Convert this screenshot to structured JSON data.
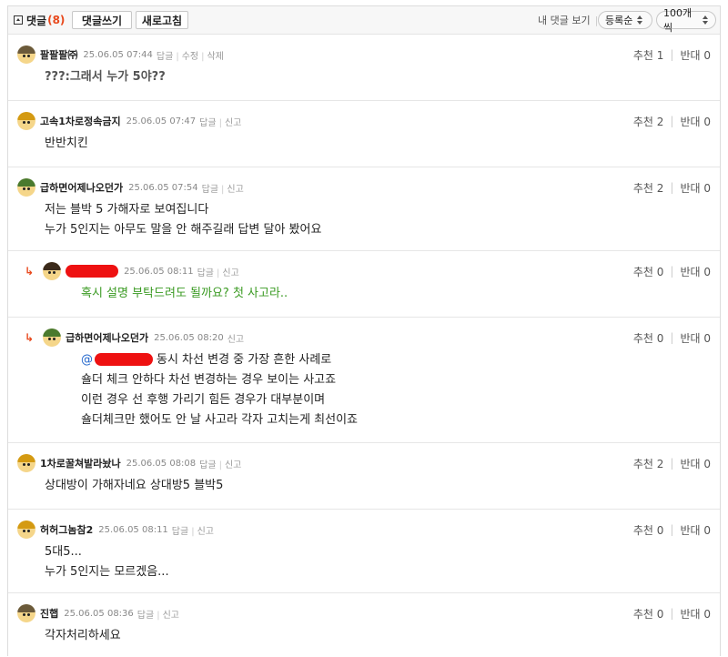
{
  "toolbar": {
    "comment_label": "댓글",
    "comment_count": "(8)",
    "write_button": "댓글쓰기",
    "refresh_button": "새로고침",
    "my_comments": "내 댓글 보기",
    "sort_select": "등록순",
    "per_page_select": "100개씩"
  },
  "comments": [
    {
      "nick": "팔팔팔㈜",
      "date": "25.06.05 07:44",
      "links": [
        "답글",
        "수정",
        "삭제"
      ],
      "up": "추천 1",
      "down": "반대 0",
      "lines": [
        "???:그래서 누가 5야??"
      ]
    },
    {
      "nick": "고속1차로정속금지",
      "date": "25.06.05 07:47",
      "links": [
        "답글",
        "신고"
      ],
      "up": "추천 2",
      "down": "반대 0",
      "lines": [
        "반반치킨"
      ]
    },
    {
      "nick": "급하면어제나오던가",
      "date": "25.06.05 07:54",
      "links": [
        "답글",
        "신고"
      ],
      "up": "추천 2",
      "down": "반대 0",
      "lines": [
        "저는 블박 5 가해자로 보여집니다",
        "누가 5인지는 아무도 말을 안 해주길래 답변 달아 봤어요"
      ]
    },
    {
      "nick": "",
      "date": "25.06.05 08:11",
      "links": [
        "답글",
        "신고"
      ],
      "up": "추천 0",
      "down": "반대 0",
      "lines": [
        "혹시 설명 부탁드려도 될까요? 첫 사고라.."
      ],
      "reply_arrow": "↳"
    },
    {
      "nick": "급하면어제나오던가",
      "date": "25.06.05 08:20",
      "links": [
        "신고"
      ],
      "up": "추천 0",
      "down": "반대 0",
      "mention": "@",
      "lines": [
        "동시 차선 변경 중 가장 흔한 사례로",
        "숄더 체크 안하다 차선 변경하는 경우 보이는 사고죠",
        "이런 경우 선 후행 가리기 힘든 경우가 대부분이며",
        "숄더체크만 했어도 안 날 사고라 각자 고치는게 최선이죠"
      ],
      "reply_arrow": "↳"
    },
    {
      "nick": "1차로꿀쳐발라놨나",
      "date": "25.06.05 08:08",
      "links": [
        "답글",
        "신고"
      ],
      "up": "추천 2",
      "down": "반대 0",
      "lines": [
        "상대방이 가해자네요 상대방5 블박5"
      ]
    },
    {
      "nick": "허허그놈참2",
      "date": "25.06.05 08:11",
      "links": [
        "답글",
        "신고"
      ],
      "up": "추천 0",
      "down": "반대 0",
      "lines": [
        "5대5...",
        "누가 5인지는 모르겠음..."
      ]
    },
    {
      "nick": "진햅",
      "date": "25.06.05 08:36",
      "links": [
        "답글",
        "신고"
      ],
      "up": "추천 0",
      "down": "반대 0",
      "lines": [
        "각자처리하세요"
      ]
    }
  ],
  "colors": {
    "accent": "#e8491d",
    "reply_text": "#3a9a22",
    "mention": "#2266cc",
    "redaction": "#ee1111"
  }
}
